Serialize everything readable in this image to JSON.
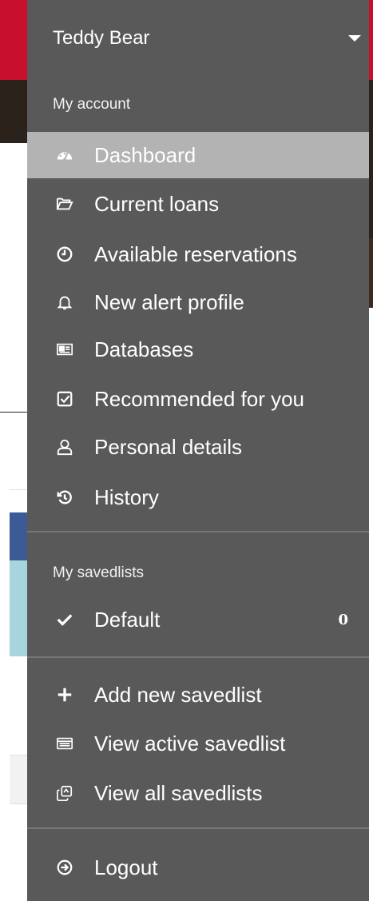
{
  "user": {
    "name": "Teddy Bear"
  },
  "my_account": {
    "label": "My account",
    "items": [
      {
        "label": "Dashboard",
        "icon": "dashboard-icon",
        "active": true
      },
      {
        "label": "Current loans",
        "icon": "folder-open-icon"
      },
      {
        "label": "Available reservations",
        "icon": "clock-icon"
      },
      {
        "label": "New alert profile",
        "icon": "bell-icon"
      },
      {
        "label": "Databases",
        "icon": "database-card-icon"
      },
      {
        "label": "Recommended for you",
        "icon": "checkbox-icon"
      },
      {
        "label": "Personal details",
        "icon": "user-icon"
      },
      {
        "label": "History",
        "icon": "history-icon"
      }
    ]
  },
  "my_savedlists": {
    "label": "My savedlists",
    "items": [
      {
        "label": "Default",
        "icon": "check-icon",
        "count": "0"
      }
    ]
  },
  "savedlist_actions": [
    {
      "label": "Add new savedlist",
      "icon": "plus-icon"
    },
    {
      "label": "View active savedlist",
      "icon": "list-view-icon"
    },
    {
      "label": "View all savedlists",
      "icon": "copy-icon"
    }
  ],
  "logout": {
    "label": "Logout",
    "icon": "logout-icon"
  },
  "colors": {
    "menu_bg": "#595959",
    "active_bg": "#b3b3b3",
    "header_red": "#c8102e"
  }
}
